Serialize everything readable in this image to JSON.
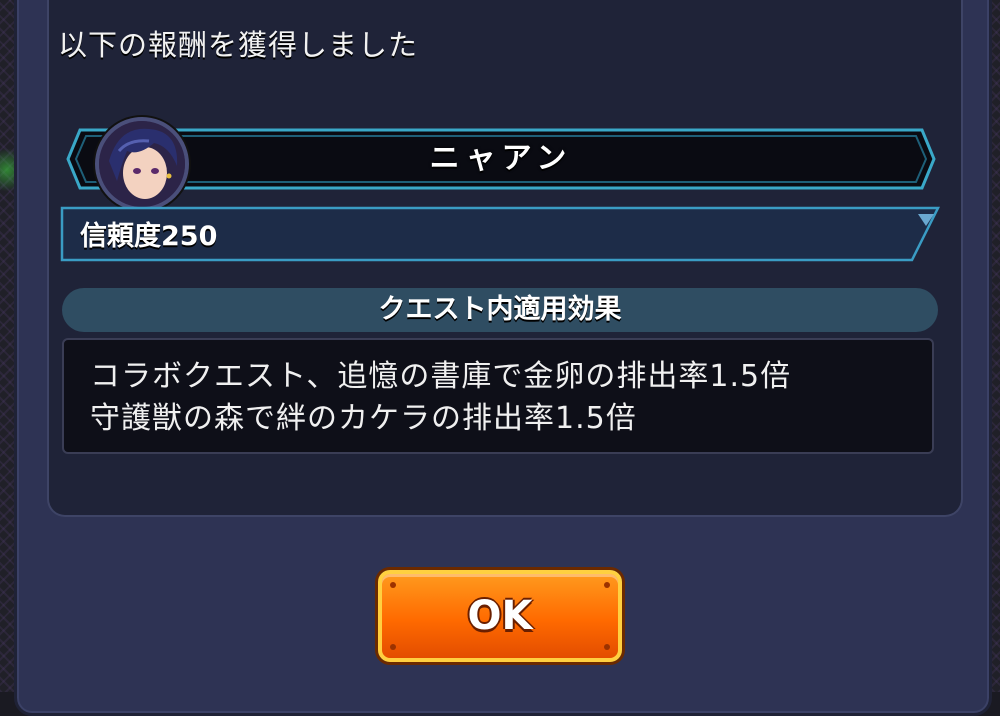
{
  "dialog": {
    "header": "以下の報酬を獲得しました"
  },
  "reward": {
    "character_name": "ニャアン",
    "trust_label": "信頼度250"
  },
  "quest_effect": {
    "title": "クエスト内適用効果",
    "lines": [
      "コラボクエスト、追憶の書庫で金卵の排出率1.5倍",
      "守護獣の森で絆のカケラの排出率1.5倍"
    ]
  },
  "ok_button": {
    "label": "OK"
  },
  "colors": {
    "dialog_bg": "#2e3354",
    "banner_border": "#3aa8c8",
    "button_orange": "#ff6a00"
  }
}
